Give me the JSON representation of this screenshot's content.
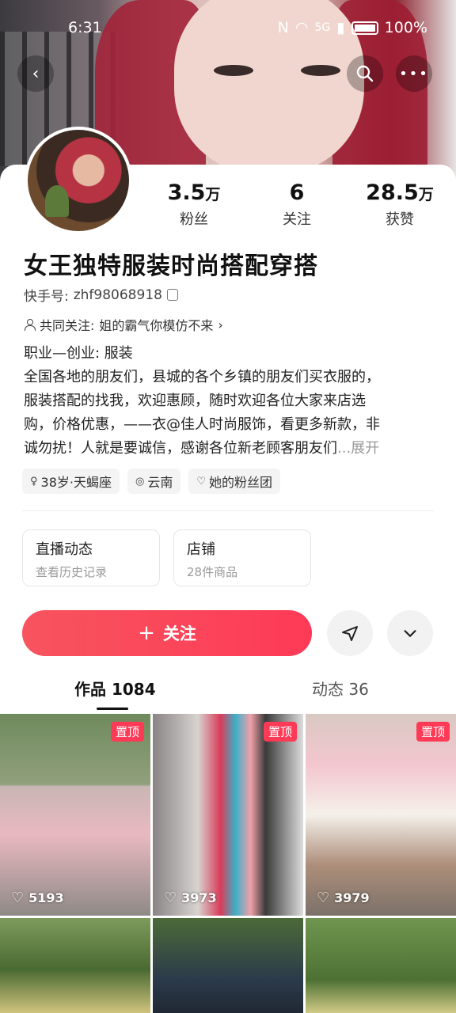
{
  "status_bar": {
    "time": "6:31",
    "nfc": "N",
    "network": "5G",
    "battery": "100%"
  },
  "profile": {
    "stats": [
      {
        "num": "3.5",
        "unit": "万",
        "label": "粉丝"
      },
      {
        "num": "6",
        "unit": "",
        "label": "关注"
      },
      {
        "num": "28.5",
        "unit": "万",
        "label": "获赞"
      }
    ],
    "name": "女王独特服装时尚搭配穿搭",
    "kuaishou_id_label": "快手号:",
    "kuaishou_id": "zhf98068918",
    "mutual_label": "共同关注:",
    "mutual_name": "姐的霸气你模仿不来",
    "bio_lines": [
      "职业—创业:   服装",
      "全国各地的朋友们，县城的各个乡镇的朋友们买衣服的，",
      "服装搭配的找我，欢迎惠顾，随时欢迎各位大家来店选",
      "购，价格优惠，——衣@佳人时尚服饰，看更多新款，非",
      "诚勿扰！人就是要诚信，感谢各位新老顾客朋友们"
    ],
    "bio_more": "...展开",
    "tags": [
      {
        "icon": "gender-icon",
        "text": "38岁·天蝎座"
      },
      {
        "icon": "location-icon",
        "text": "云南"
      },
      {
        "icon": "fan-group-icon",
        "text": "她的粉丝团"
      }
    ]
  },
  "cards": [
    {
      "title": "直播动态",
      "subtitle": "查看历史记录"
    },
    {
      "title": "店铺",
      "subtitle": "28件商品"
    }
  ],
  "actions": {
    "follow_label": "关注"
  },
  "tabs": [
    {
      "label": "作品 1084"
    },
    {
      "label": "动态 36"
    }
  ],
  "videos": [
    {
      "pinned": "置顶",
      "likes": "5193"
    },
    {
      "pinned": "置顶",
      "likes": "3973"
    },
    {
      "pinned": "置顶",
      "likes": "3979"
    },
    {
      "pinned": "",
      "likes": ""
    },
    {
      "pinned": "",
      "likes": ""
    },
    {
      "pinned": "",
      "likes": ""
    }
  ],
  "colors": {
    "accent": "#fe3a57"
  }
}
